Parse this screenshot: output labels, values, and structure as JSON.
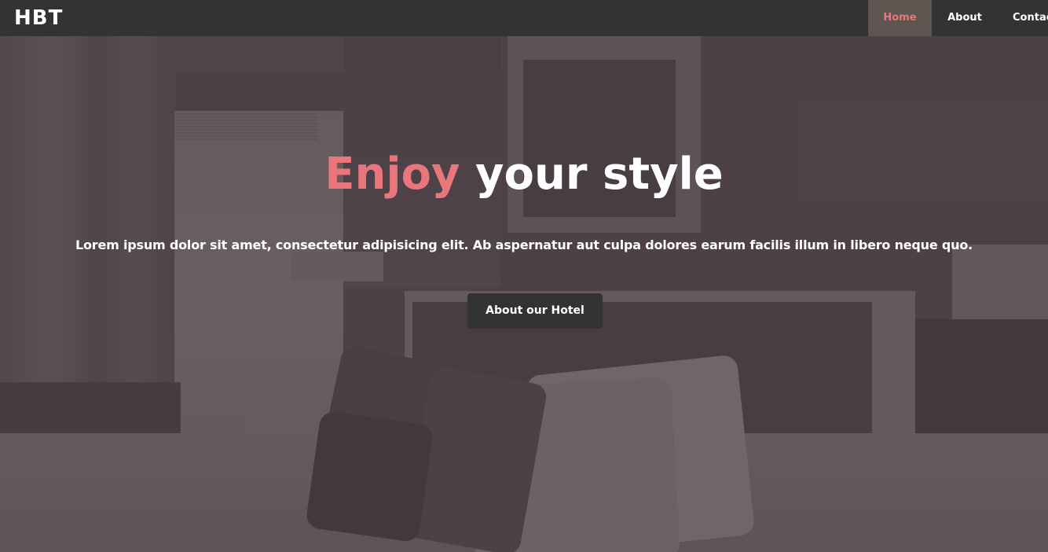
{
  "navbar": {
    "brand": "HBT",
    "items": [
      {
        "label": "Home",
        "active": true
      },
      {
        "label": "About",
        "active": false
      },
      {
        "label": "Contac",
        "active": false
      }
    ]
  },
  "hero": {
    "headline_accent": "Enjoy",
    "headline_rest": " your style",
    "subtext": "Lorem ipsum dolor sit amet, consectetur adipisicing elit. Ab aspernatur aut culpa dolores earum facilis illum in libero neque quo.",
    "cta_label": "About our Hotel"
  },
  "colors": {
    "navbar_bg": "#333333",
    "active_nav_bg": "#5e5551",
    "accent": "#e8767b",
    "button_bg": "#333333",
    "text": "#ffffff"
  }
}
